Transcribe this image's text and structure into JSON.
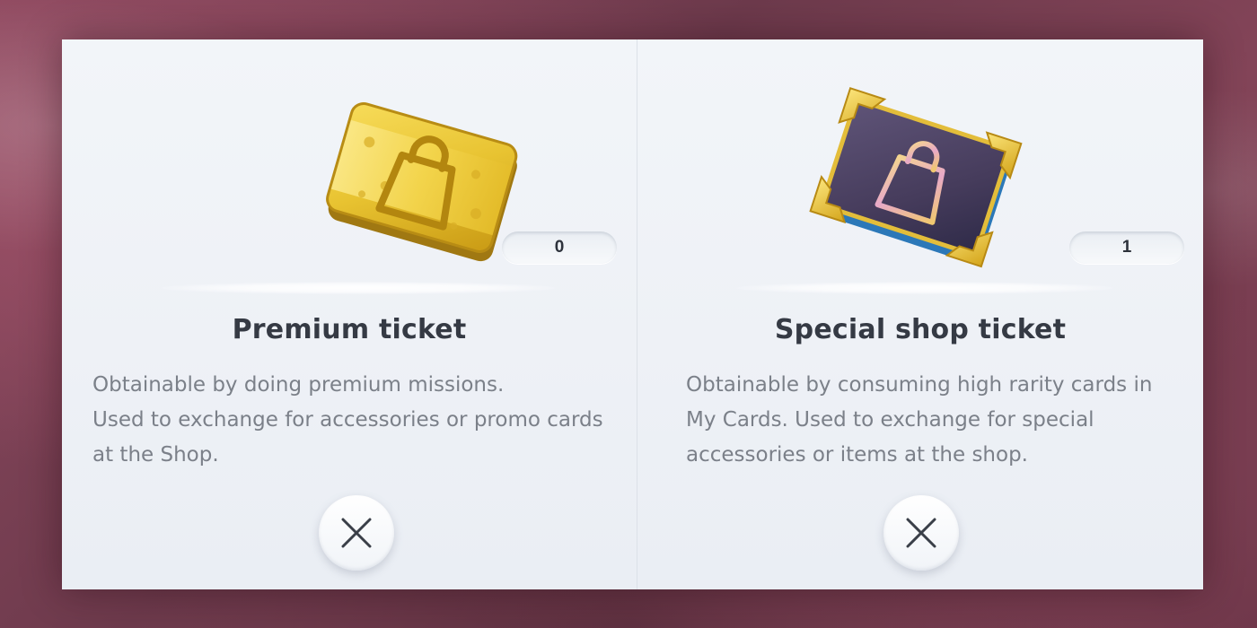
{
  "premium_ticket": {
    "icon": "premium-ticket-icon",
    "count": "0",
    "title": "Premium ticket",
    "description_lines": [
      "Obtainable by doing premium missions.",
      "Used to exchange for accessories or promo cards",
      "at the Shop."
    ],
    "close_icon": "close-icon"
  },
  "special_shop_ticket": {
    "icon": "special-shop-ticket-icon",
    "count": "1",
    "title": "Special shop ticket",
    "description_lines": [
      "Obtainable by consuming high rarity cards in",
      "My Cards. Used to exchange for special",
      "accessories or items at the shop."
    ],
    "close_icon": "close-icon"
  },
  "colors": {
    "gold": "#e0b92a",
    "purple_ticket": "#4a3f63",
    "panel_background": "#eef1f6",
    "title_text": "#353a44",
    "description_text": "#7b8089"
  }
}
